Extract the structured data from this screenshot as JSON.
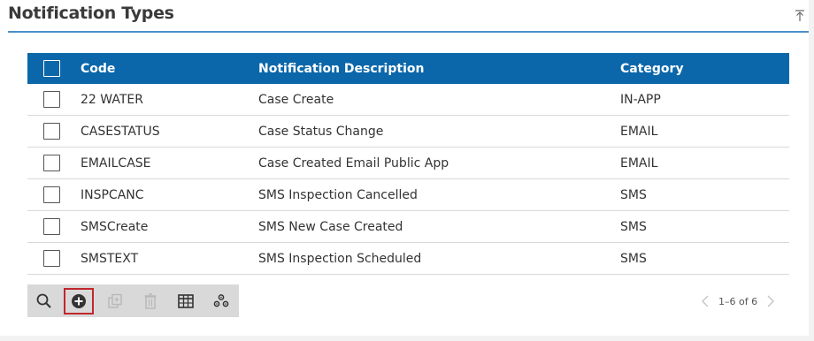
{
  "panel": {
    "title": "Notification Types",
    "collapse_icon": "collapse-up-icon"
  },
  "grid": {
    "columns": {
      "code": "Code",
      "description": "Notification Description",
      "category": "Category"
    },
    "rows": [
      {
        "code": "22 WATER",
        "description": "Case Create",
        "category": "IN-APP"
      },
      {
        "code": "CASESTATUS",
        "description": "Case Status Change",
        "category": "EMAIL"
      },
      {
        "code": "EMAILCASE",
        "description": "Case Created Email Public App",
        "category": "EMAIL"
      },
      {
        "code": "INSPCANC",
        "description": "SMS Inspection Cancelled",
        "category": "SMS"
      },
      {
        "code": "SMSCreate",
        "description": "SMS New Case Created",
        "category": "SMS"
      },
      {
        "code": "SMSTEXT",
        "description": "SMS Inspection Scheduled",
        "category": "SMS"
      }
    ]
  },
  "toolbar": {
    "buttons": [
      "search-icon",
      "add-circle-icon",
      "copy-icon",
      "delete-icon",
      "columns-icon",
      "settings-icon"
    ],
    "highlight_color": "#c0272d"
  },
  "pager": {
    "range": "1–6 of 6"
  },
  "colors": {
    "header_bg": "#0b67aa",
    "accent_rule": "#4a8fca",
    "toolbar_bg": "#d9d9d9"
  }
}
